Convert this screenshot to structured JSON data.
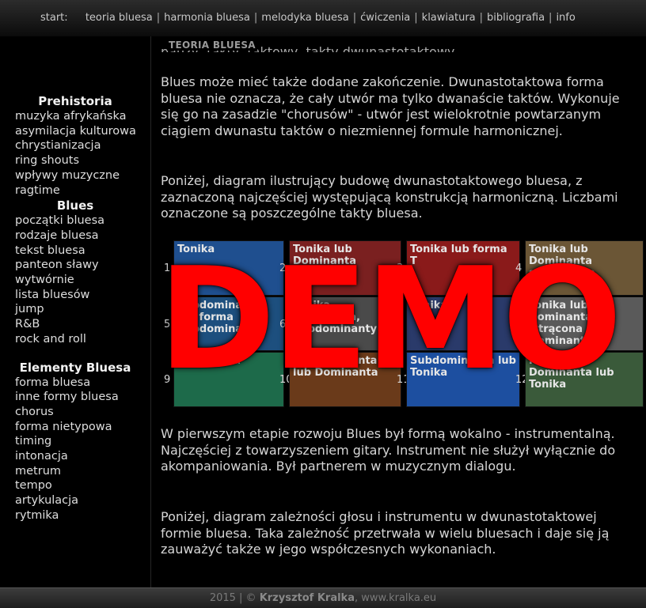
{
  "nav": {
    "start_label": "start:",
    "items": [
      {
        "label": "teoria bluesa",
        "sep": "|"
      },
      {
        "label": "harmonia bluesa",
        "sep": "|"
      },
      {
        "label": "melodyka bluesa",
        "sep": "|"
      },
      {
        "label": "ćwiczenia",
        "sep": "|"
      },
      {
        "label": "klawiatura",
        "sep": "|"
      },
      {
        "label": "bibliografia",
        "sep": "|"
      },
      {
        "label": "info",
        "sep": ""
      }
    ]
  },
  "sidebar": {
    "sections": [
      {
        "title": "Prehistoria",
        "items": [
          "muzyka afrykańska",
          "asymilacja kulturowa",
          "chrystianizacja",
          "ring shouts",
          "wpływy muzyczne",
          "ragtime"
        ]
      },
      {
        "title": "Blues",
        "items": [
          "początki bluesa",
          "rodzaje bluesa",
          "tekst bluesa",
          "panteon sławy",
          "wytwórnie",
          "lista bluesów",
          "jump",
          "R&B",
          "rock and roll"
        ]
      },
      {
        "title": "Elementy Bluesa",
        "items": [
          "forma bluesa",
          "inne formy bluesa",
          "chorus",
          "forma nietypowa",
          "timing",
          "intonacja",
          "metrum",
          "tempo",
          "artykulacja",
          "rytmika"
        ]
      }
    ]
  },
  "content": {
    "breadcrumb": "TEORIA BLUESA",
    "para_top_cut": "pauzy, takty, taktowy, takty dwunastotaktowy.",
    "para1": "Blues może mieć także dodane zakończenie. Dwunastotaktowa forma bluesa nie oznacza, że cały utwór ma tylko dwanaście taktów. Wykonuje się go na zasadzie \"chorusów\" - utwór jest wielokrotnie powtarzanym ciągiem dwunastu taktów o niezmiennej formule harmonicznej.",
    "para2": "Poniżej, diagram ilustrujący budowę dwunastotaktowego bluesa, z zaznaczoną najczęściej występującą konstrukcją harmoniczną. Liczbami oznaczone są poszczególne takty bluesa.",
    "para3": "W pierwszym etapie rozwoju Blues był formą wokalno - instrumentalną. Najczęściej z towarzyszeniem gitary. Instrument nie służył wyłącznie do akompaniowania. Był partnerem w muzycznym dialogu.",
    "para4": "Poniżej, diagram zależności głosu i instrumentu w dwunastotaktowej formie bluesa. Taka zależność przetrwała w wielu bluesach i daje się ją zauważyć także w jego współczesnych wykonaniach."
  },
  "diagram": {
    "row1": [
      {
        "num": "1",
        "label": "Tonika",
        "color": "#1f4f8f"
      },
      {
        "num": "2",
        "label": "Tonika lub Dominanta",
        "color": "#7a2020"
      },
      {
        "num": "3",
        "label": "Tonika lub forma T",
        "color": "#8a1a1a"
      },
      {
        "num": "4",
        "label": "Tonika lub Dominanta septymowa",
        "color": "#6b5636"
      }
    ],
    "row2": [
      {
        "num": "5",
        "label": "Subdominanta lub forma Subdominanty",
        "color": "#1d4f7e"
      },
      {
        "num": "6",
        "label": "Tonika, Dominanta, Subdominanty",
        "color": "#4a4a4a"
      },
      {
        "num": "7",
        "label": "Tonika",
        "color": "#2a3a6a"
      },
      {
        "num": "8",
        "label": "Tonika lub Dominanta wtrącona do Dominanty",
        "color": "#5a5a5a"
      }
    ],
    "row3": [
      {
        "num": "9",
        "label": "Dominanta",
        "color": "#1d6a4a"
      },
      {
        "num": "10",
        "label": "Subdominanta lub Dominanta",
        "color": "#6a3a1a"
      },
      {
        "num": "11",
        "label": "Subdominanta lub Tonika",
        "color": "#1d4fa0"
      },
      {
        "num": "12",
        "label": "Kadencja Dominanta lub Tonika",
        "color": "#3a5a3a"
      }
    ]
  },
  "overlay": {
    "watermark": "DEMO"
  },
  "footer": {
    "year": "2015 | ©",
    "author": "Krzysztof Kralka",
    "site": ", www.kralka.eu"
  }
}
